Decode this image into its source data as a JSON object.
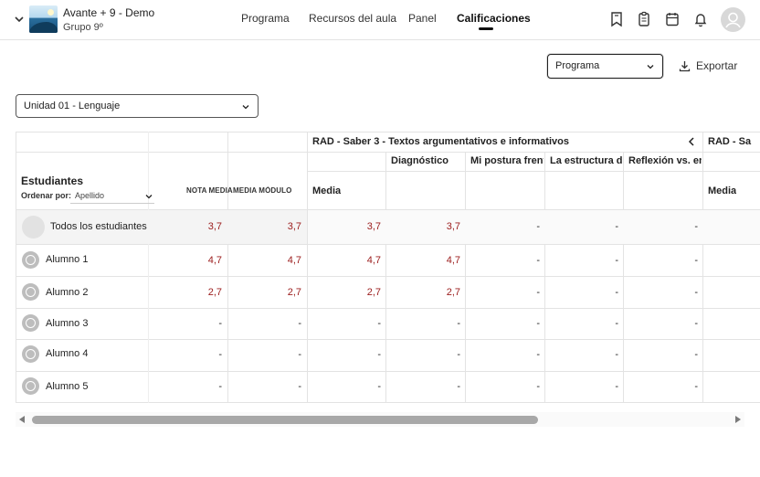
{
  "header": {
    "course_title": "Avante + 9 - Demo",
    "course_group": "Grupo 9º",
    "nav": [
      "Programa",
      "Recursos del aula",
      "Panel",
      "Calificaciones"
    ],
    "active_nav": "Calificaciones",
    "icons": [
      "bookmark-icon",
      "clipboard-icon",
      "calendar-icon",
      "bell-icon",
      "user-avatar"
    ]
  },
  "toolbar": {
    "view_select_value": "Programa",
    "export_label": "Exportar"
  },
  "unit_select": {
    "value": "Unidad 01 - Lenguaje"
  },
  "table": {
    "students_header": "Estudiantes",
    "sort_label": "Ordenar por:",
    "sort_value": "Apellido",
    "nota_media": "NOTA MEDIA",
    "media_modulo": "MEDIA MÓDULO",
    "group1_title": "RAD - Saber 3 - Textos argumentativos e informativos",
    "group2_title": "RAD - Sa",
    "subcolumns": [
      "Diagnóstico",
      "Mi postura frent",
      "La estructura de",
      "Reflexión vs. ens"
    ],
    "media_label": "Media",
    "media_label_2": "Media",
    "rows": [
      {
        "name": "Todos los estudiantes",
        "values": [
          "3,7",
          "3,7",
          "3,7",
          "3,7",
          "-",
          "-",
          "-"
        ]
      },
      {
        "name": "Alumno 1",
        "values": [
          "4,7",
          "4,7",
          "4,7",
          "4,7",
          "-",
          "-",
          "-"
        ]
      },
      {
        "name": "Alumno 2",
        "values": [
          "2,7",
          "2,7",
          "2,7",
          "2,7",
          "-",
          "-",
          "-"
        ]
      },
      {
        "name": "Alumno 3",
        "values": [
          "-",
          "-",
          "-",
          "-",
          "-",
          "-",
          "-"
        ]
      },
      {
        "name": "Alumno 4",
        "values": [
          "-",
          "-",
          "-",
          "-",
          "-",
          "-",
          "-"
        ]
      },
      {
        "name": "Alumno 5",
        "values": [
          "-",
          "-",
          "-",
          "-",
          "-",
          "-",
          "-"
        ]
      }
    ]
  },
  "colors": {
    "grade_red": "#9b1b1b",
    "border": "#e3e3e3",
    "scroll_thumb": "#a8a8a8"
  }
}
